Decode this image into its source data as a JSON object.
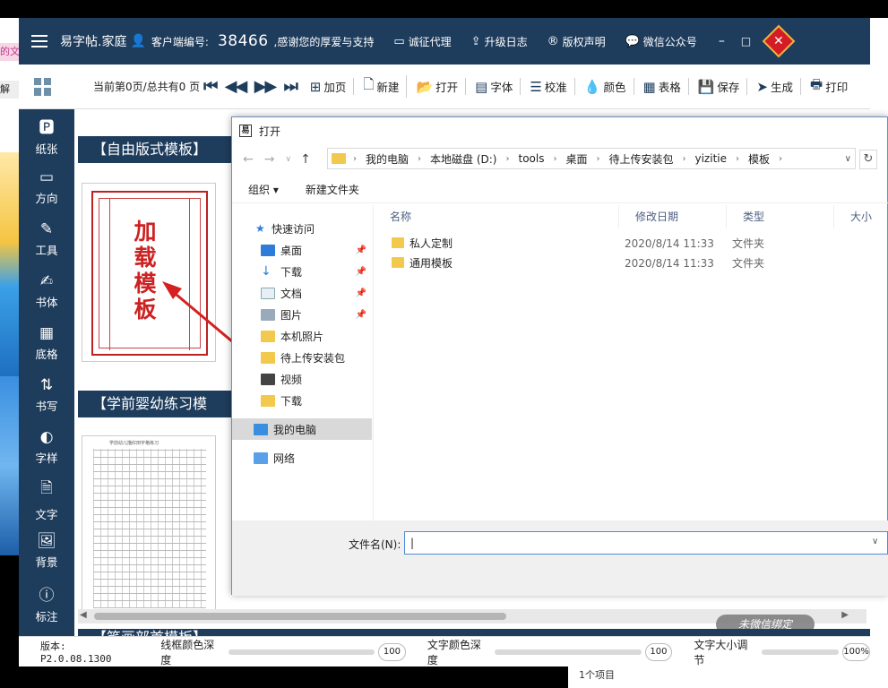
{
  "background": {
    "pink_snippet": "的文",
    "button_snippet": "解",
    "item_count": "1个项目"
  },
  "titlebar": {
    "app_name": "易字帖.家庭",
    "client_label": "客户端编号:",
    "client_num": "38466",
    "thanks": ",感谢您的厚爱与支持",
    "buttons": [
      "诚征代理",
      "升级日志",
      "版权声明",
      "微信公众号"
    ],
    "minimize": "–",
    "maximize": "□",
    "logo_glyph": "✕"
  },
  "toolbar": {
    "page_info": "当前第0页/总共有0 页",
    "nav": [
      "⏮",
      "◀◀",
      "▶▶",
      "⏭"
    ],
    "buttons": [
      "加页",
      "新建",
      "打开",
      "字体",
      "校准",
      "颜色",
      "表格",
      "保存",
      "生成",
      "打印"
    ]
  },
  "sidebar": {
    "items": [
      "纸张",
      "方向",
      "工具",
      "书体",
      "底格",
      "书写",
      "字样",
      "文字",
      "背景",
      "标注"
    ]
  },
  "content": {
    "section1": "【自由版式模板】",
    "section2": "【学前婴幼练习模",
    "section3": "【笔画部首模板】",
    "thumb1_text": "加载模板",
    "thumb2_title": "学前幼儿描红田字格练习",
    "watermark": "未微信绑定"
  },
  "statusbar": {
    "version": "版本: P2.0.08.1300",
    "frame_depth_label": "线框颜色深度",
    "frame_depth_value": "100",
    "text_depth_label": "文字颜色深度",
    "text_depth_value": "100",
    "text_size_label": "文字大小调节",
    "text_size_value": "100%"
  },
  "dialog": {
    "title": "打开",
    "breadcrumbs": [
      "我的电脑",
      "本地磁盘 (D:)",
      "tools",
      "桌面",
      "待上传安装包",
      "yizitie",
      "模板"
    ],
    "organize": "组织 ▾",
    "new_folder": "新建文件夹",
    "nav_items": [
      {
        "label": "快速访问",
        "pinned": false
      },
      {
        "label": "桌面",
        "pinned": true
      },
      {
        "label": "下载",
        "pinned": true
      },
      {
        "label": "文档",
        "pinned": true
      },
      {
        "label": "图片",
        "pinned": true
      },
      {
        "label": "本机照片",
        "pinned": false
      },
      {
        "label": "待上传安装包",
        "pinned": false
      },
      {
        "label": "视频",
        "pinned": false
      },
      {
        "label": "下载",
        "pinned": false
      },
      {
        "label": "我的电脑",
        "pinned": false
      },
      {
        "label": "网络",
        "pinned": false
      }
    ],
    "columns": [
      "名称",
      "修改日期",
      "类型",
      "大小"
    ],
    "files": [
      {
        "name": "私人定制",
        "date": "2020/8/14 11:33",
        "type": "文件夹"
      },
      {
        "name": "通用模板",
        "date": "2020/8/14 11:33",
        "type": "文件夹"
      }
    ],
    "filename_label": "文件名(N):",
    "filename_value": ""
  },
  "colors": {
    "brand": "#1e3c5c",
    "accent_red": "#c22222",
    "folder": "#f2c94c"
  }
}
